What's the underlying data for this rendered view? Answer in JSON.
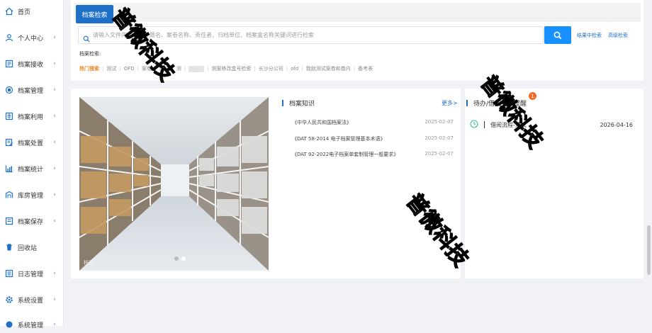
{
  "sidebar": {
    "items": [
      {
        "label": "首页",
        "icon": "home-icon",
        "has_arrow": false
      },
      {
        "label": "个人中心",
        "icon": "user-icon",
        "has_arrow": true
      },
      {
        "label": "档案接收",
        "icon": "inbox-icon",
        "has_arrow": true
      },
      {
        "label": "档案管理",
        "icon": "folder-gear-icon",
        "has_arrow": true
      },
      {
        "label": "档案利用",
        "icon": "document-use-icon",
        "has_arrow": true
      },
      {
        "label": "档案处置",
        "icon": "document-edit-icon",
        "has_arrow": true
      },
      {
        "label": "档案统计",
        "icon": "bar-chart-icon",
        "has_arrow": true
      },
      {
        "label": "库房管理",
        "icon": "warehouse-icon",
        "has_arrow": true
      },
      {
        "label": "档案保存",
        "icon": "archive-save-icon",
        "has_arrow": true
      },
      {
        "label": "回收站",
        "icon": "trash-icon",
        "has_arrow": false
      },
      {
        "label": "日志管理",
        "icon": "log-icon",
        "has_arrow": true
      },
      {
        "label": "系统设置",
        "icon": "gear-icon",
        "has_arrow": true
      },
      {
        "label": "系统管理",
        "icon": "system-icon",
        "has_arrow": true
      }
    ],
    "arrow_glyph": "‹"
  },
  "search": {
    "tab_label": "档案检索",
    "placeholder": "请输入文件内容、文件题名、案卷名称、责任者、归档单位、档案盒名称关键词进行检索",
    "result_search_label": "结果中检索",
    "advanced_search_label": "高级检索",
    "archive_search_label": "档案检索:",
    "hot_title": "热门搜索",
    "hot_terms": [
      "测试",
      "OFD",
      "案卷",
      "测试",
      "测",
      "",
      "测案移改盒号检索",
      "长沙分公司",
      "ofd",
      "我就测试案卷和卷内",
      "备考表"
    ]
  },
  "photo": {
    "caption": "档案"
  },
  "knowledge": {
    "title": "档案知识",
    "more_label": "更多>",
    "items": [
      {
        "title": "《中华人民共和国档案法》",
        "date": "2025-02-07"
      },
      {
        "title": "《DAT 58-2014 电子档案管理基本术语》",
        "date": "2025-02-07"
      },
      {
        "title": "《DAT 92-2022电子档案单套制管理一般要求》",
        "date": "2025-02-07"
      }
    ]
  },
  "notice": {
    "title": "待办/借阅到期提醒",
    "badge": "1",
    "items": [
      {
        "title": "借阅流程-测试",
        "date": "2026-04-16"
      }
    ]
  },
  "watermark": {
    "text": "普微科技"
  },
  "colors": {
    "primary": "#1e6fc8",
    "search_button": "#1890ff",
    "hot_accent": "#e8892b",
    "badge": "#ee6b2a",
    "background": "#f0f2f5"
  }
}
